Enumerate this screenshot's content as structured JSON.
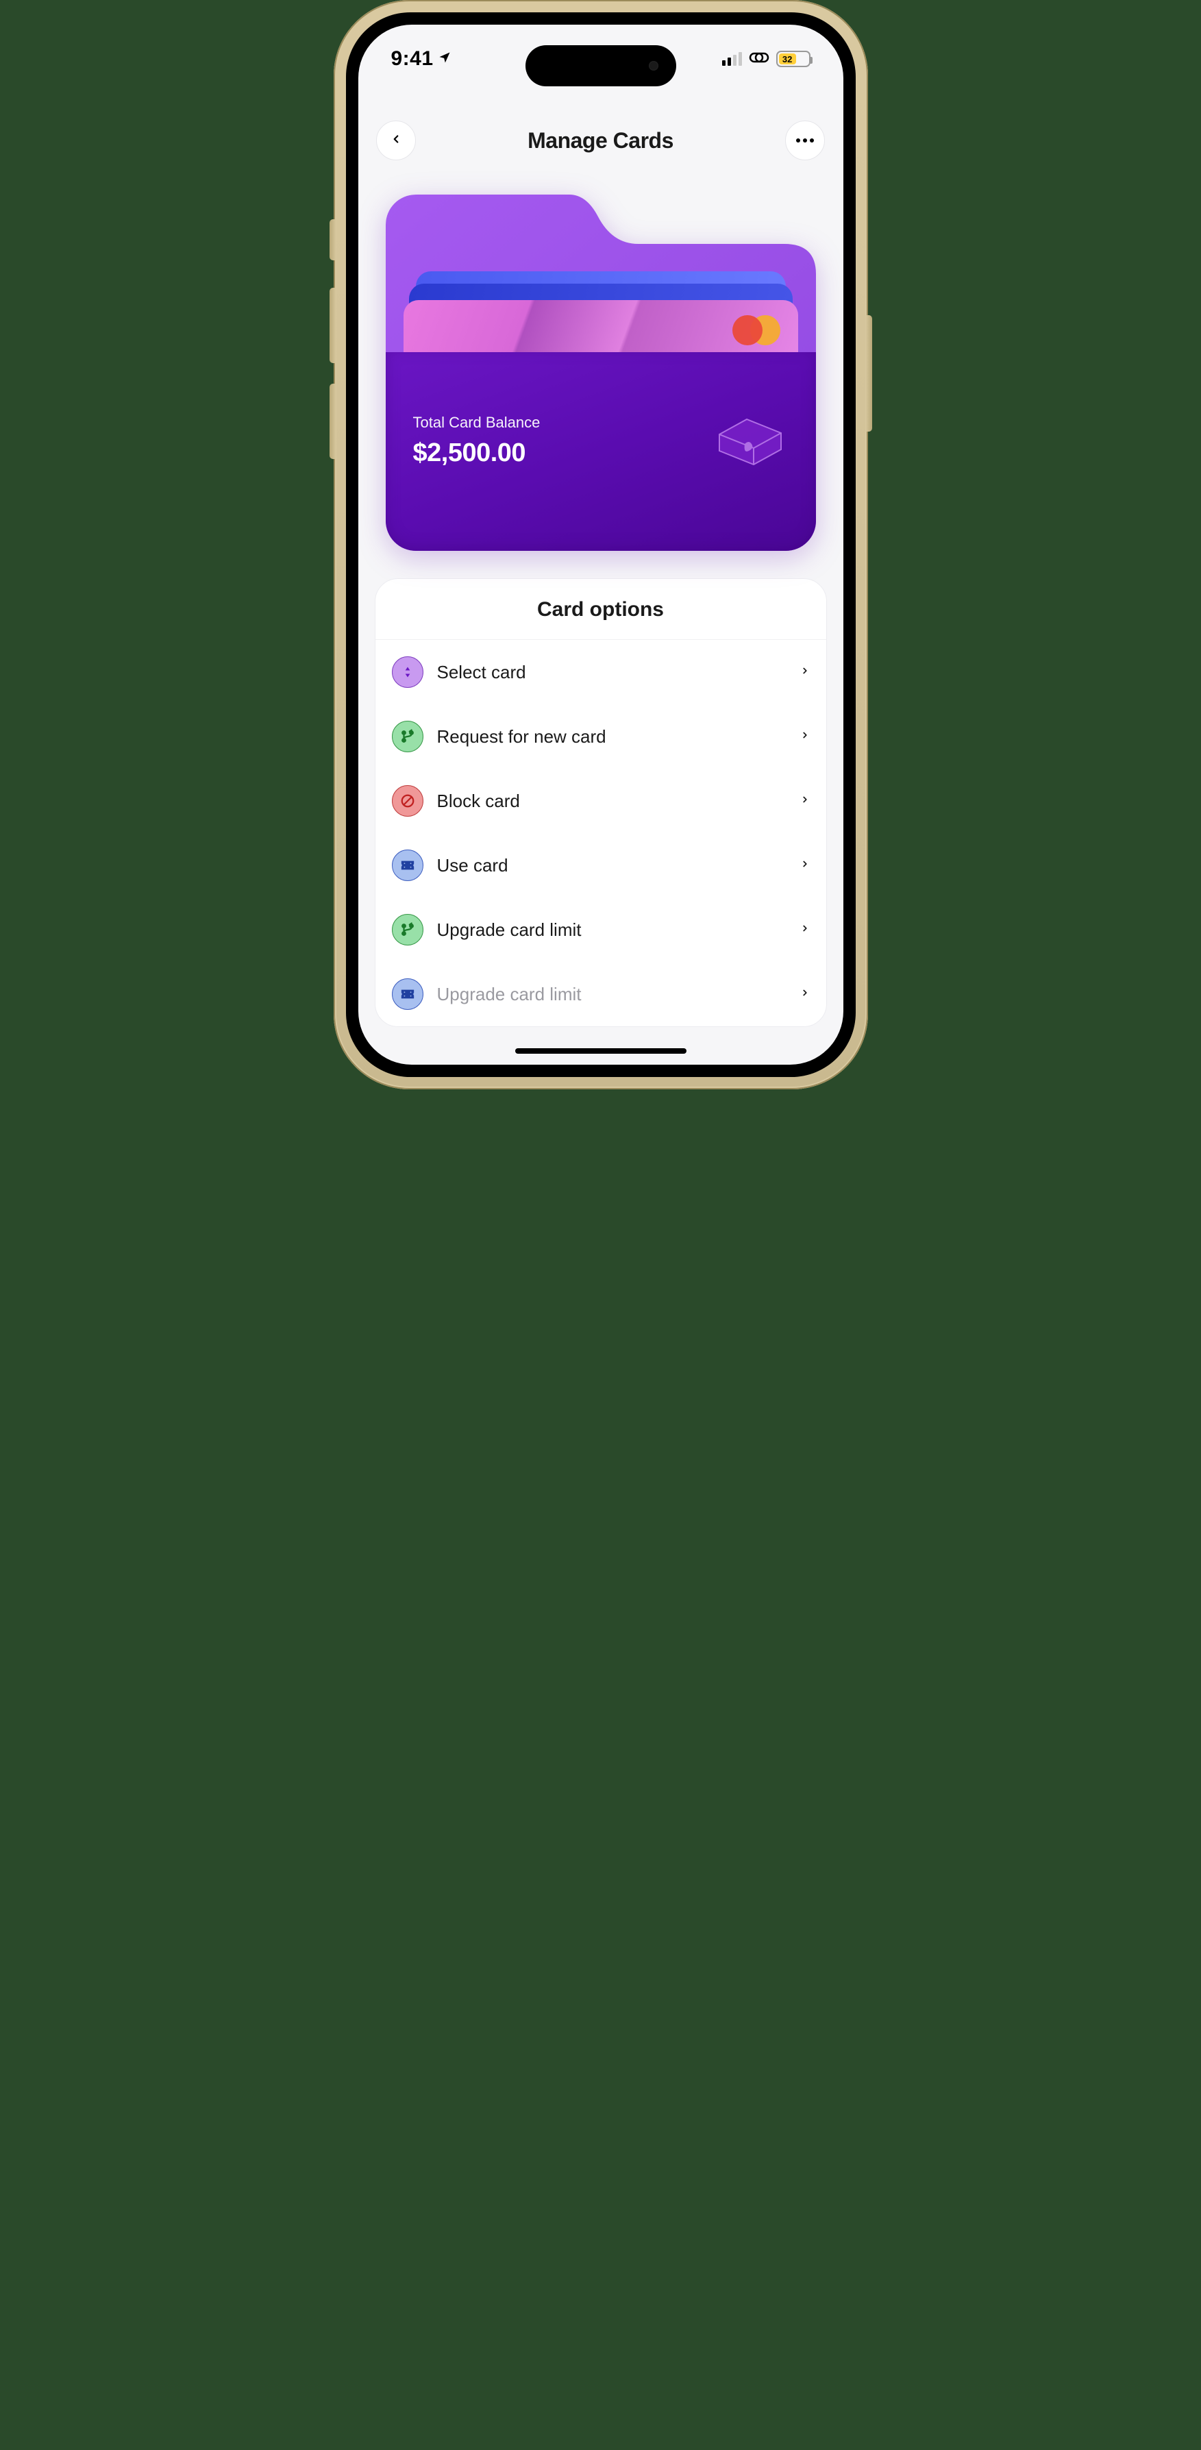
{
  "status": {
    "time": "9:41",
    "battery": "32"
  },
  "nav": {
    "title": "Manage Cards"
  },
  "wallet": {
    "balance_label": "Total Card Balance",
    "balance_value": "$2,500.00"
  },
  "options": {
    "title": "Card options",
    "items": [
      {
        "label": "Select card",
        "icon": "sort",
        "scheme": "purple"
      },
      {
        "label": "Request for new card",
        "icon": "branch",
        "scheme": "green"
      },
      {
        "label": "Block card",
        "icon": "block",
        "scheme": "red"
      },
      {
        "label": "Use card",
        "icon": "ticket",
        "scheme": "blue"
      },
      {
        "label": "Upgrade card limit",
        "icon": "branch",
        "scheme": "green"
      },
      {
        "label": "Upgrade card limit",
        "icon": "ticket",
        "scheme": "blue"
      }
    ]
  }
}
